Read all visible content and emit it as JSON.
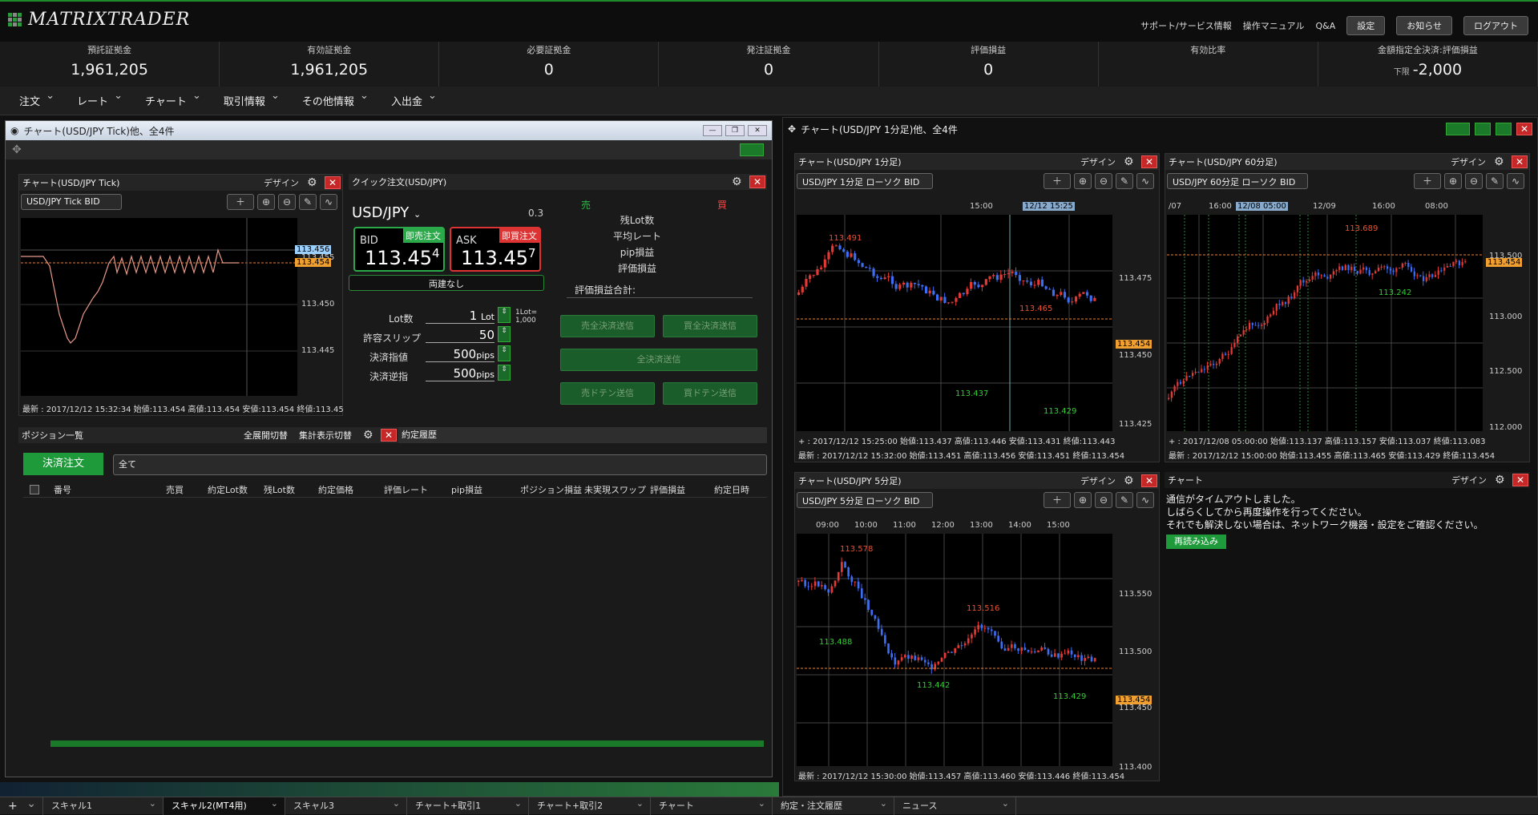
{
  "app": {
    "logo": "MATRIXTRADER"
  },
  "toplinks": {
    "support": "サポート/サービス情報",
    "manual": "操作マニュアル",
    "qa": "Q&A",
    "settings": "設定",
    "news": "お知らせ",
    "logout": "ログアウト"
  },
  "stats": [
    {
      "label": "預託証拠金",
      "value": "1,961,205"
    },
    {
      "label": "有効証拠金",
      "value": "1,961,205"
    },
    {
      "label": "必要証拠金",
      "value": "0"
    },
    {
      "label": "発注証拠金",
      "value": "0"
    },
    {
      "label": "評価損益",
      "value": "0"
    },
    {
      "label": "有効比率",
      "value": ""
    },
    {
      "label": "金額指定全決済:評価損益",
      "value": "-2,000",
      "sub": "下限"
    }
  ],
  "menu": [
    "注文",
    "レート",
    "チャート",
    "取引情報",
    "その他情報",
    "入出金"
  ],
  "left_window": {
    "title": "チャート(USD/JPY Tick)他、全4件",
    "tick_chart": {
      "title": "チャート(USD/JPY Tick)",
      "design": "デザイン",
      "select": "USD/JPY Tick BID",
      "y_labels": [
        "113.456",
        "113.455",
        "113.454",
        "113.450",
        "113.445"
      ],
      "footer": "最新 : 2017/12/12 15:32:34 始値:113.454 高値:113.454 安値:113.454 終値:113.45"
    },
    "quick_order": {
      "title": "クイック注文(USD/JPY)",
      "pair": "USD/JPY",
      "spread": "0.3",
      "sell": "売",
      "buy": "買",
      "bid_label": "BID",
      "bid_btn": "即売注文",
      "bid_main": "113.45",
      "bid_last": "4",
      "ask_label": "ASK",
      "ask_btn": "即買注文",
      "ask_main": "113.45",
      "ask_last": "7",
      "ryodate": "両建なし",
      "info": [
        "残Lot数",
        "平均レート",
        "pip損益",
        "評価損益"
      ],
      "total": "評価損益合計:",
      "lot_label": "Lot数",
      "lot_val": "1",
      "lot_unit": "Lot",
      "lot_note": "1Lot= 1,000",
      "slip_label": "許容スリップ",
      "slip_val": "50",
      "limit_label": "決済指値",
      "limit_val": "500",
      "limit_unit": "pips",
      "stop_label": "決済逆指",
      "stop_val": "500",
      "stop_unit": "pips",
      "btn_sell_all": "売全決済送信",
      "btn_buy_all": "買全決済送信",
      "btn_all": "全決済送信",
      "btn_sell_doten": "売ドテン送信",
      "btn_buy_doten": "買ドテン送信"
    },
    "positions": {
      "title": "ポジション一覧",
      "expand": "全展開切替",
      "summary": "集計表示切替",
      "history_tab": "約定履歴",
      "settle_btn": "決済注文",
      "filter": "全て",
      "columns": [
        "番号",
        "売買",
        "約定Lot数",
        "残Lot数",
        "約定価格",
        "評価レート",
        "pip損益",
        "ポジション損益",
        "未実現スワップ",
        "評価損益",
        "約定日時"
      ]
    }
  },
  "right_window": {
    "title": "チャート(USD/JPY 1分足)他、全4件",
    "c1": {
      "title": "チャート(USD/JPY 1分足)",
      "design": "デザイン",
      "select": "USD/JPY 1分足 ローソク BID",
      "times": [
        "15:00",
        "12/12 15:25"
      ],
      "y_labels": [
        "113.475",
        "113.450",
        "113.425"
      ],
      "cur": "113.454",
      "hi1": "113.491",
      "hi2": "113.465",
      "lo1": "113.437",
      "lo2": "113.429",
      "cursor": "+ : 2017/12/12 15:25:00 始値:113.437 高値:113.446 安値:113.431 終値:113.443",
      "footer": "最新 : 2017/12/12 15:32:00 始値:113.451 高値:113.456 安値:113.451 終値:113.454"
    },
    "c2": {
      "title": "チャート(USD/JPY 60分足)",
      "design": "デザイン",
      "select": "USD/JPY 60分足 ローソク BID",
      "times": [
        "/07",
        "16:00",
        "12/08 05:00",
        "12/09",
        "16:00",
        "08:00"
      ],
      "y_labels": [
        "113.500",
        "113.000",
        "112.500",
        "112.000"
      ],
      "cur": "113.454",
      "hi": "113.689",
      "lo": "113.242",
      "cursor": "+ : 2017/12/08 05:00:00 始値:113.137 高値:113.157 安値:113.037 終値:113.083",
      "footer": "最新 : 2017/12/12 15:00:00 始値:113.455 高値:113.465 安値:113.429 終値:113.454"
    },
    "c3": {
      "title": "チャート(USD/JPY 5分足)",
      "design": "デザイン",
      "select": "USD/JPY 5分足 ローソク BID",
      "times": [
        "09:00",
        "10:00",
        "11:00",
        "12:00",
        "13:00",
        "14:00",
        "15:00"
      ],
      "y_labels": [
        "113.550",
        "113.500",
        "113.450",
        "113.400"
      ],
      "cur": "113.454",
      "hi1": "113.578",
      "hi2": "113.516",
      "lo1": "113.488",
      "lo2": "113.442",
      "lo3": "113.429",
      "footer": "最新 : 2017/12/12 15:30:00 始値:113.457 高値:113.460 安値:113.446 終値:113.454"
    },
    "c4": {
      "title": "チャート",
      "design": "デザイン",
      "msg1": "通信がタイムアウトしました。",
      "msg2": "しばらくしてから再度操作を行ってください。",
      "msg3": "それでも解決しない場合は、ネットワーク機器・設定をご確認ください。",
      "reload": "再読み込み"
    }
  },
  "tabs": [
    "+",
    "スキャル1",
    "スキャル2(MT4用)",
    "スキャル3",
    "チャート+取引1",
    "チャート+取引2",
    "チャート",
    "約定・注文履歴",
    "ニュース"
  ]
}
